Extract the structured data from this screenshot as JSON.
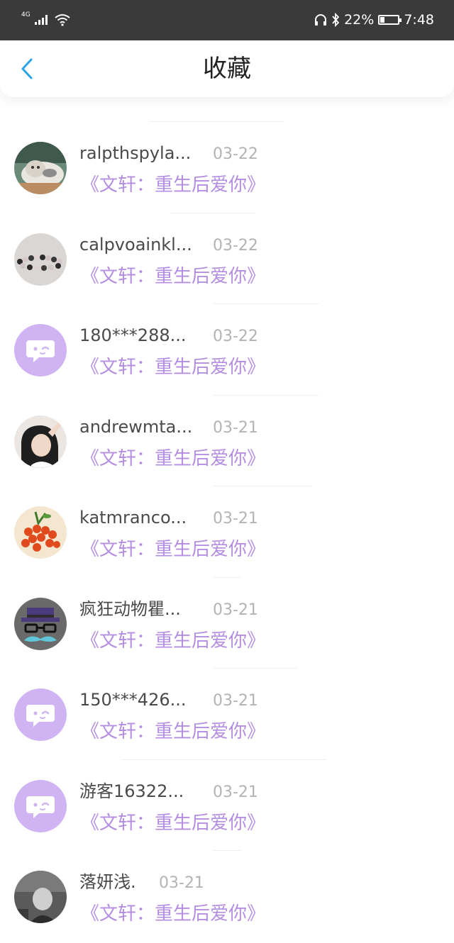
{
  "status_bar": {
    "network": "4G",
    "battery_percent": "22%",
    "time": "7:48"
  },
  "header": {
    "title": "收藏"
  },
  "colors": {
    "accent_blue": "#2aa3e8",
    "book_purple": "#b48ee0",
    "default_avatar": "#cfb3f2"
  },
  "items": [
    {
      "name": "ralpthspyla...",
      "date": "03-22",
      "book": "《文轩：重生后爱你》",
      "avatar": "cat-photo-avatar"
    },
    {
      "name": "calpvoainkl...",
      "date": "03-22",
      "book": "《文轩：重生后爱你》",
      "avatar": "bracelet-photo-avatar"
    },
    {
      "name": "180***288...",
      "date": "03-22",
      "book": "《文轩：重生后爱你》",
      "avatar": "default-chat-avatar"
    },
    {
      "name": "andrewmta...",
      "date": "03-21",
      "book": "《文轩：重生后爱你》",
      "avatar": "person-photo-avatar"
    },
    {
      "name": "katmranco...",
      "date": "03-21",
      "book": "《文轩：重生后爱你》",
      "avatar": "fruit-photo-avatar"
    },
    {
      "name": "疯狂动物瞿...",
      "date": "03-21",
      "book": "《文轩：重生后爱你》",
      "avatar": "hat-glasses-avatar"
    },
    {
      "name": "150***426...",
      "date": "03-21",
      "book": "《文轩：重生后爱你》",
      "avatar": "default-chat-avatar"
    },
    {
      "name": "游客16322...",
      "date": "03-21",
      "book": "《文轩：重生后爱你》",
      "avatar": "default-chat-avatar"
    },
    {
      "name": "落妍浅.",
      "date": "03-21",
      "book": "《文轩：重生后爱你》",
      "avatar": "dark-photo-avatar"
    }
  ]
}
